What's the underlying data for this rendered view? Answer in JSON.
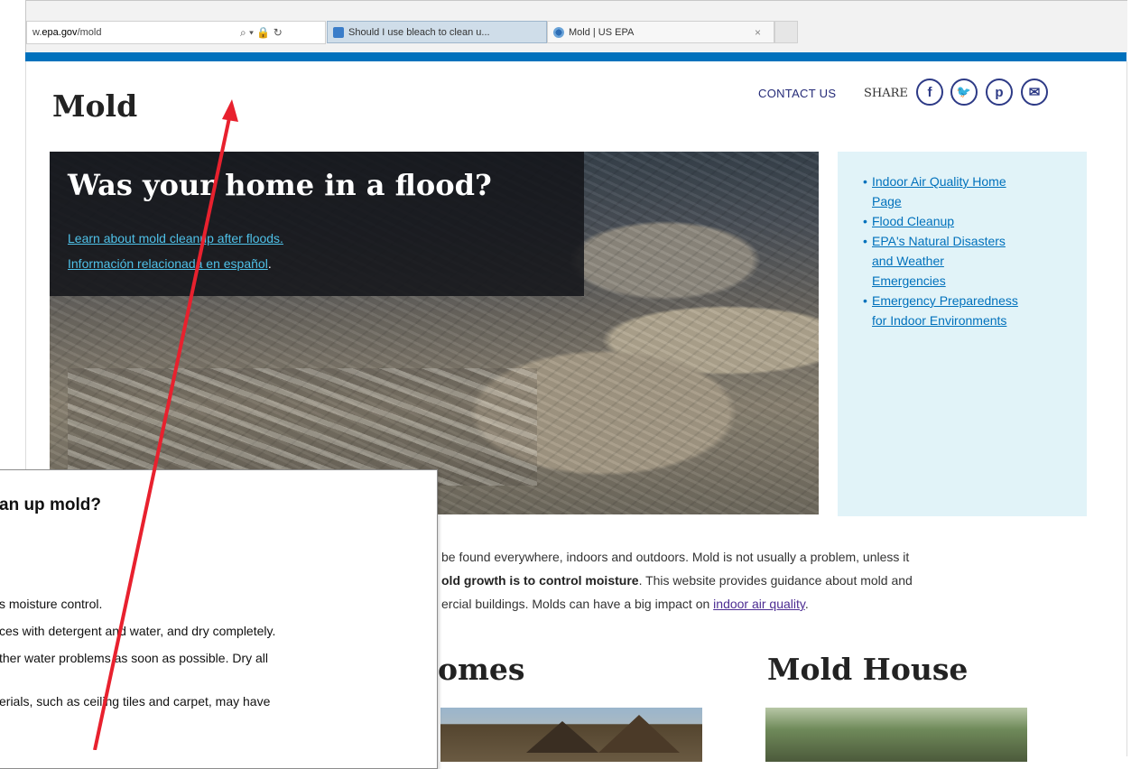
{
  "browser": {
    "url_prefix": "w.",
    "url_domain": "epa.gov",
    "url_path": "/mold",
    "url_icons": "⌕ ▾ 🔒 ↻",
    "tabs": [
      {
        "title": "Should I use bleach to clean u..."
      },
      {
        "title": "Mold | US EPA"
      }
    ],
    "close_symbol": "×"
  },
  "header": {
    "title": "Mold",
    "contact": "CONTACT US",
    "share": "SHARE",
    "social": [
      {
        "name": "facebook",
        "glyph": "f"
      },
      {
        "name": "twitter",
        "glyph": "🐦"
      },
      {
        "name": "pinterest",
        "glyph": "p"
      },
      {
        "name": "email",
        "glyph": "✉"
      }
    ]
  },
  "hero": {
    "title": "Was your home in a flood?",
    "link1": "Learn about mold cleanup after floods.",
    "link2": "Información relacionada en español",
    "link2_suffix": "."
  },
  "sidebar": {
    "items": [
      {
        "line1": "Indoor Air Quality Home",
        "line2": "Page"
      },
      {
        "line1": "Flood Cleanup"
      },
      {
        "line1": "EPA's Natural Disasters",
        "line2": "and Weather",
        "line3": "Emergencies"
      },
      {
        "line1": "Emergency Preparedness",
        "line2": "for Indoor Environments"
      }
    ]
  },
  "body": {
    "line1": "be found everywhere, indoors and outdoors. Mold is not usually a problem, unless it",
    "line2_bold": "old growth is to control moisture",
    "line2_rest": ". This website provides guidance about mold and",
    "line3_pre": "ercial buildings. Molds can have a big impact on ",
    "line3_link": "indoor air quality",
    "line3_post": ".",
    "heading_homes": "omes",
    "heading_house": "Mold House"
  },
  "overlay": {
    "heading": "an up mold?",
    "lines": [
      "s moisture control.",
      "ces with detergent and water, and dry completely.",
      "ther water problems as soon as possible.  Dry all",
      "erials, such as ceiling tiles and carpet, may have"
    ]
  },
  "colors": {
    "epa_blue": "#0071bc",
    "link_purple": "#4c2c92",
    "arrow_red": "#e8212e",
    "sidebar_bg": "#e1f3f8"
  }
}
